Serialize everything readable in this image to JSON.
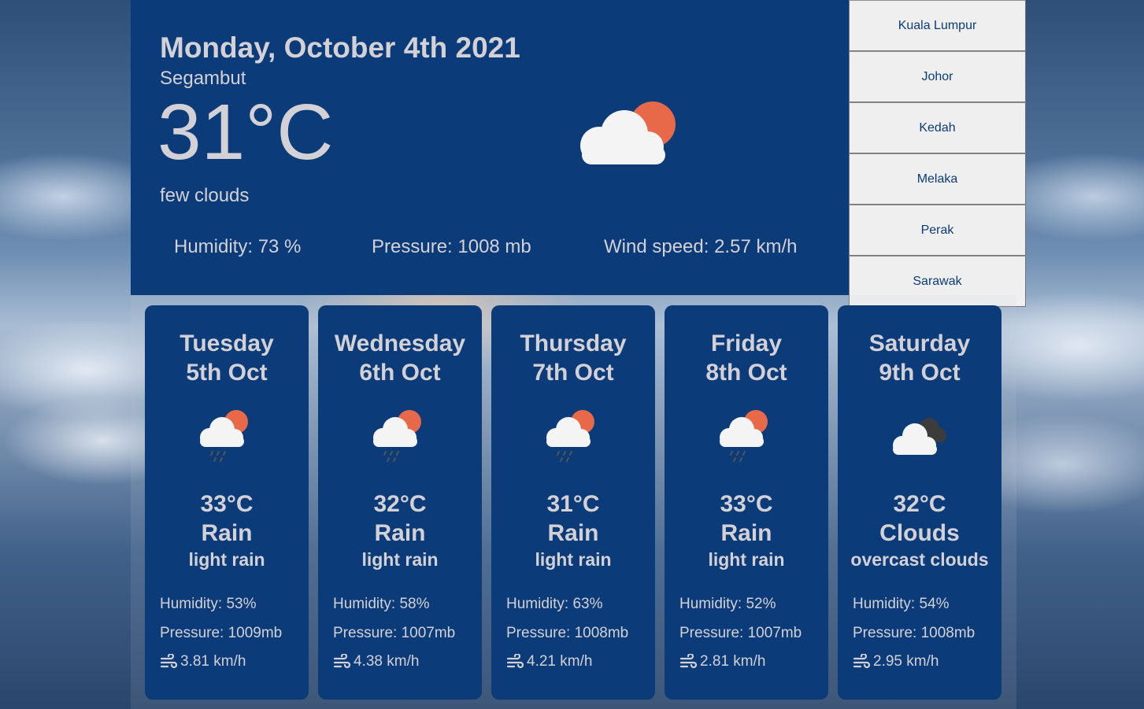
{
  "current": {
    "date": "Monday, October 4th 2021",
    "location": "Segambut",
    "temperature": "31°C",
    "description": "few clouds",
    "humidity": "Humidity: 73 %",
    "pressure": "Pressure: 1008 mb",
    "wind": "Wind speed: 2.57 km/h",
    "icon": "few-clouds-icon"
  },
  "cities": [
    "Kuala Lumpur",
    "Johor",
    "Kedah",
    "Melaka",
    "Perak",
    "Sarawak"
  ],
  "forecast": [
    {
      "day": "Tuesday",
      "date": "5th Oct",
      "temp": "33°C",
      "main": "Rain",
      "desc": "light rain",
      "humidity": "Humidity: 53%",
      "pressure": "Pressure: 1009mb",
      "wind": "3.81 km/h",
      "icon": "rain-icon"
    },
    {
      "day": "Wednesday",
      "date": "6th Oct",
      "temp": "32°C",
      "main": "Rain",
      "desc": "light rain",
      "humidity": "Humidity: 58%",
      "pressure": "Pressure: 1007mb",
      "wind": "4.38 km/h",
      "icon": "rain-icon"
    },
    {
      "day": "Thursday",
      "date": "7th Oct",
      "temp": "31°C",
      "main": "Rain",
      "desc": "light rain",
      "humidity": "Humidity: 63%",
      "pressure": "Pressure: 1008mb",
      "wind": "4.21 km/h",
      "icon": "rain-icon"
    },
    {
      "day": "Friday",
      "date": "8th Oct",
      "temp": "33°C",
      "main": "Rain",
      "desc": "light rain",
      "humidity": "Humidity: 52%",
      "pressure": "Pressure: 1007mb",
      "wind": "2.81 km/h",
      "icon": "rain-icon"
    },
    {
      "day": "Saturday",
      "date": "9th Oct",
      "temp": "32°C",
      "main": "Clouds",
      "desc": "overcast clouds",
      "humidity": "Humidity: 54%",
      "pressure": "Pressure: 1008mb",
      "wind": "2.95 km/h",
      "icon": "overcast-clouds-icon"
    }
  ],
  "colors": {
    "panel": "#0b3b78",
    "text": "#d3d1d6",
    "sun": "#e8694a",
    "cloud": "#f4f4f4",
    "dark_cloud": "#3c3c3c",
    "button_bg": "#efefef",
    "button_text": "#0b3b78"
  }
}
